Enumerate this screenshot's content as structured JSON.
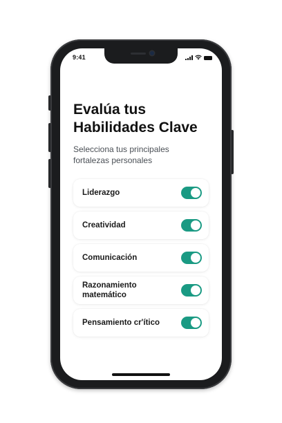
{
  "status_bar": {
    "time": "9:41",
    "icons": [
      "signal-icon",
      "wifi-icon",
      "battery-icon"
    ]
  },
  "header": {
    "title_line1": "Evalúa tus",
    "title_line2": "Habilidades Clave",
    "subtitle_line1": "Selecciona tus principales",
    "subtitle_line2": "fortalezas personales"
  },
  "skills": [
    {
      "label": "Liderazgo",
      "enabled": true
    },
    {
      "label": "Creatividad",
      "enabled": true
    },
    {
      "label": "Comunicación",
      "enabled": true
    },
    {
      "label": "Razonamiento matemático",
      "enabled": true
    },
    {
      "label": "Pensamiento cr'ítico",
      "enabled": true
    }
  ],
  "colors": {
    "accent": "#1a9a83",
    "phone_frame": "#1b1c1e",
    "text_primary": "#111111",
    "text_secondary": "#4a4f55"
  }
}
